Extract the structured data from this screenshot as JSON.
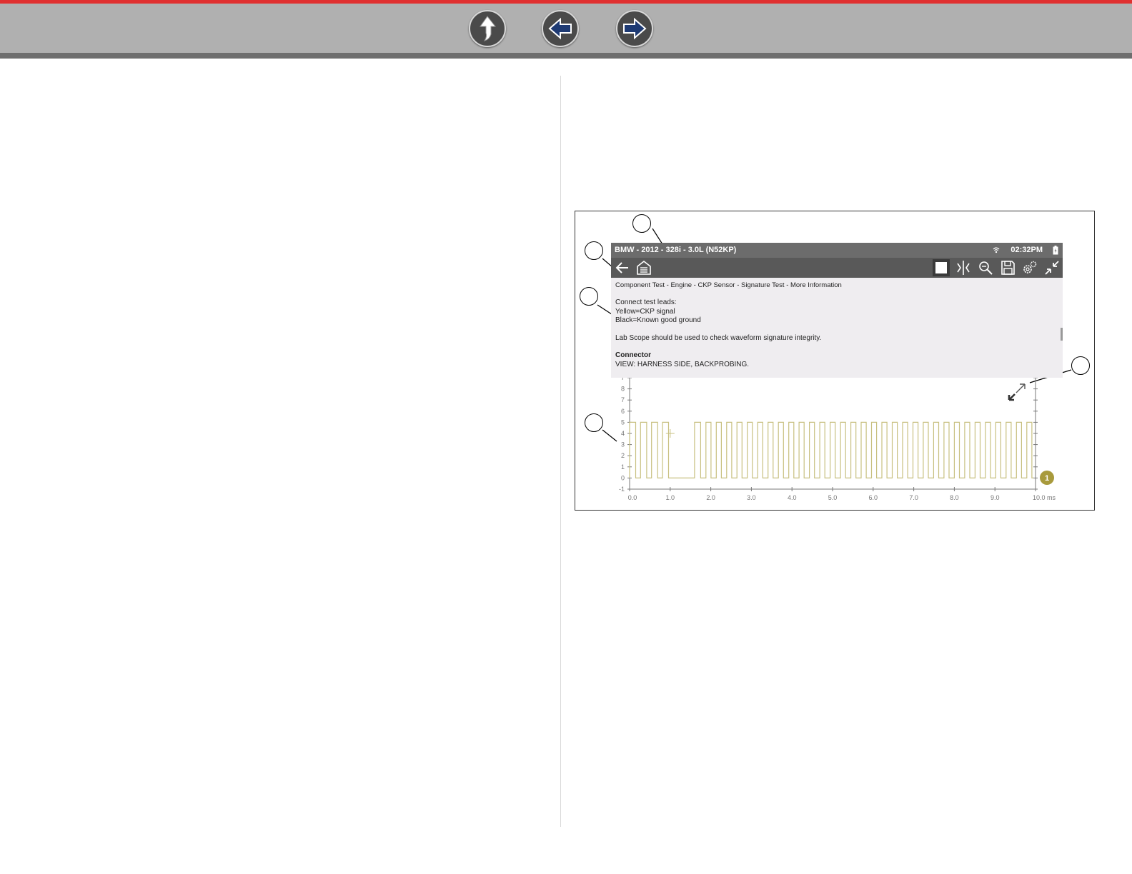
{
  "status_bar": {
    "vehicle": "BMW - 2012 - 328i - 3.0L (N52KP)",
    "time": "02:32PM"
  },
  "toolbar": {
    "icons": [
      "back-icon",
      "home-icon",
      "stop-icon",
      "split-screen-icon",
      "zoom-icon",
      "save-icon",
      "settings-icon",
      "fullscreen-exit-icon"
    ]
  },
  "info_panel": {
    "breadcrumb": "Component Test - Engine - CKP Sensor - Signature Test - More Information",
    "line1": "Connect test leads:",
    "line2": "Yellow=CKP signal",
    "line3": "Black=Known good ground",
    "line4": "Lab Scope should be used to check waveform signature integrity.",
    "heading": "Connector",
    "line5": "VIEW: HARNESS SIDE, BACKPROBING."
  },
  "chart_data": {
    "type": "line",
    "xlabel": "",
    "ylabel": "",
    "x_ticks": [
      "0.0",
      "1.0",
      "2.0",
      "3.0",
      "4.0",
      "5.0",
      "6.0",
      "7.0",
      "8.0",
      "9.0",
      "10.0 ms"
    ],
    "y_ticks": [
      "-1",
      "0",
      "1",
      "2",
      "3",
      "4",
      "5",
      "6",
      "7",
      "8",
      "7"
    ],
    "xlim": [
      0,
      10
    ],
    "ylim": [
      -1,
      9
    ],
    "channel_badge": "1",
    "trace_color": "#c8c080",
    "series": [
      {
        "x": [
          0.0,
          0.0,
          0.15,
          0.15,
          0.27,
          0.27,
          0.42,
          0.42,
          0.54,
          0.54,
          0.69,
          0.69,
          0.81,
          0.81,
          0.96,
          0.96,
          1.6,
          1.6,
          1.75,
          1.75,
          9.95
        ],
        "y": [
          0,
          5,
          5,
          0,
          0,
          5,
          5,
          0,
          0,
          5,
          5,
          0,
          0,
          5,
          5,
          0,
          0,
          5,
          5,
          0,
          0
        ]
      }
    ],
    "cursor": {
      "x": 1.0,
      "y": 4.0
    }
  },
  "colors": {
    "accent": "#e03030",
    "trace": "#c8c080",
    "badge": "#a89a3c"
  }
}
